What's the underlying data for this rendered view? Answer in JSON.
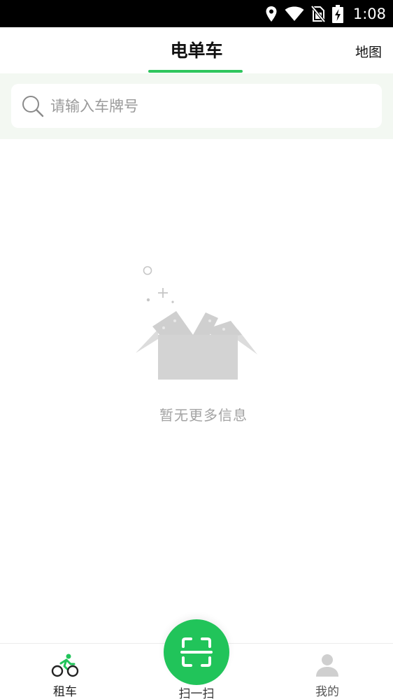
{
  "status_bar": {
    "time": "1:08",
    "icons": [
      "location-icon",
      "wifi-icon",
      "no-sim-icon",
      "battery-charging-icon"
    ]
  },
  "header": {
    "title": "电单车",
    "map_label": "地图"
  },
  "search": {
    "placeholder": "请输入车牌号",
    "value": ""
  },
  "empty_state": {
    "message": "暂无更多信息",
    "icon": "empty-box-icon"
  },
  "bottom_nav": {
    "rent_label": "租车",
    "scan_label": "扫一扫",
    "mine_label": "我的",
    "active_tab": "rent"
  },
  "colors": {
    "accent": "#21c45a",
    "search_bg": "#f3f8f2",
    "muted_text": "#a3a3a3"
  }
}
